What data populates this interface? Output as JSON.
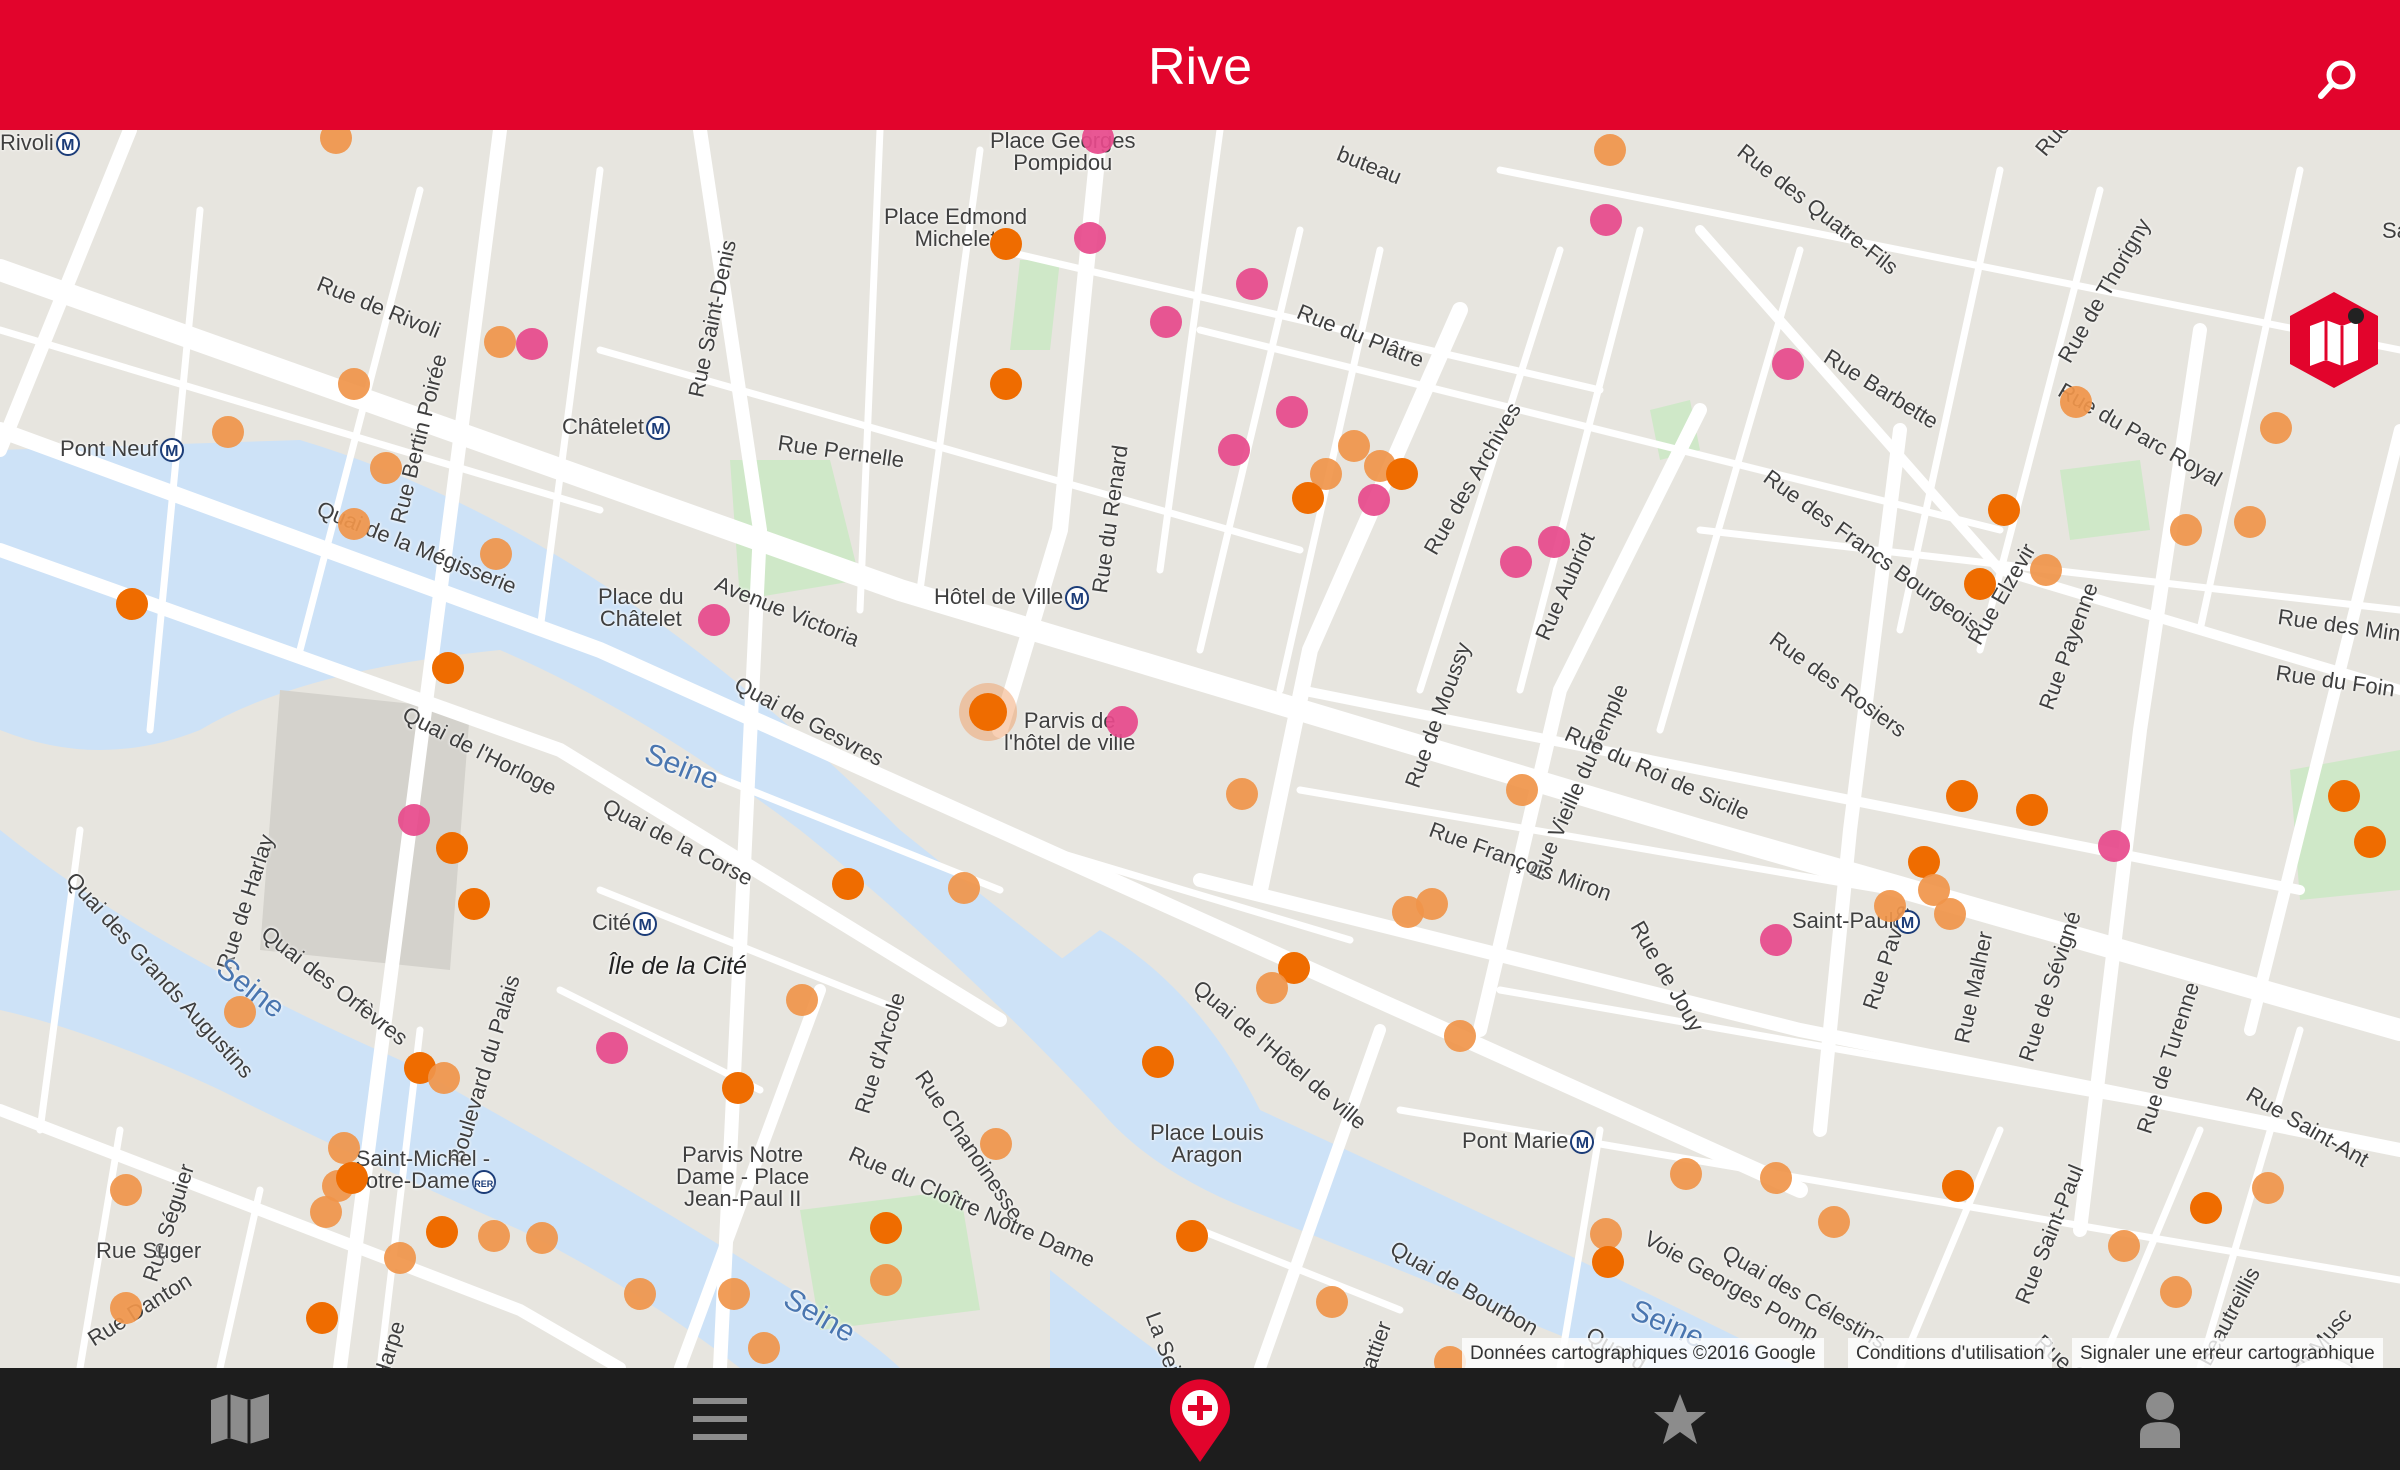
{
  "appbar": {
    "title": "Rive",
    "search_icon": "search-icon",
    "color": "#e2042c"
  },
  "map": {
    "streets": [
      "Rue de Rivoli",
      "Rue Saint-Denis",
      "Rue Bertin Poirée",
      "Rue Pernelle",
      "Quai de la Mégisserie",
      "Avenue Victoria",
      "Quai de Gesvres",
      "Quai de l'Horloge",
      "Quai de la Corse",
      "Quai des Orfèvres",
      "Quai des Grands Augustins",
      "Boulevard du Palais",
      "Rue de Harlay",
      "Rue Séguier",
      "Rue Suger",
      "Rue Danton",
      "Harpe",
      "Rue d'Arcole",
      "Rue Chanoinesse",
      "Rue du Cloître Notre Dame",
      "La Seine",
      "Quai de l'Hôtel de ville",
      "Quai de Bourbon",
      "Regrattier",
      "Quai d",
      "Voie Georges Pomp",
      "Quai des Célestins",
      "Rue du Renard",
      "Rue du Plâtre",
      "Rue des Archives",
      "Rue de Moussy",
      "Rue Aubriot",
      "Rue Vieille du Temple",
      "Rue des Francs Bourgeois",
      "Rue des Rosiers",
      "Rue du Roi de Sicile",
      "Rue François Miron",
      "Rue de Jouy",
      "Rue Pavée",
      "Rue Malher",
      "Rue de Sévigné",
      "Rue de Turenne",
      "Rue Saint-Paul",
      "Rue Saint-Ant",
      "Rue Beautreillis",
      "Rue du Petit Musc",
      "Rue Charles V",
      "Rue Barbette",
      "Rue Elzevir",
      "Rue Payenne",
      "Rue du Parc Royal",
      "Rue de Thorigny",
      "Rue des Quatre-Fils",
      "Rue des Min",
      "Rue du Foin",
      "buteau",
      "Rue",
      "Sa"
    ],
    "places": [
      "Place Georges\nPompidou",
      "Place Edmond\nMichelet",
      "Place du\nChâtelet",
      "Parvis de\nl'hôtel de ville",
      "Parvis Notre\nDame - Place\nJean-Paul II",
      "Place Louis\nAragon",
      "Île de la Cité"
    ],
    "metro": [
      {
        "name": "Rivoli",
        "icon": "metro-icon"
      },
      {
        "name": "Pont Neuf",
        "icon": "metro-icon"
      },
      {
        "name": "Châtelet",
        "icon": "metro-icon"
      },
      {
        "name": "Hôtel de Ville",
        "icon": "metro-icon"
      },
      {
        "name": "Cité",
        "icon": "metro-icon"
      },
      {
        "name": "Saint-Paul",
        "icon": "metro-icon"
      },
      {
        "name": "Pont Marie",
        "icon": "metro-icon"
      },
      {
        "name": "Saint-Michel -\nNotre-Dame",
        "icon": "rer-icon"
      }
    ],
    "water": [
      "Seine",
      "Seine",
      "Seine",
      "Seine"
    ],
    "markers": {
      "orange": "#ef6c00",
      "light_orange": "#f0954a",
      "pink": "#e7498b"
    },
    "metro_symbol": "M",
    "rer_symbol": "RER"
  },
  "attribution": {
    "google": "Google",
    "data": "Données cartographiques ©2016 Google",
    "terms": "Conditions d'utilisation",
    "report": "Signaler une erreur cartographique"
  },
  "fab": {
    "guide_icon": "guide-book-icon",
    "locate_icon": "navigation-arrow-icon"
  },
  "navbar": {
    "items": [
      {
        "icon": "map-icon"
      },
      {
        "icon": "list-menu-icon"
      },
      {
        "icon": "location-pin-icon",
        "active": true
      },
      {
        "icon": "star-icon"
      },
      {
        "icon": "user-icon"
      }
    ]
  }
}
